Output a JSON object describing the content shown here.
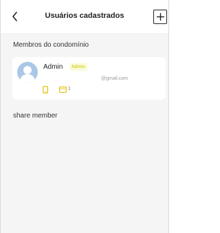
{
  "header": {
    "title": "Usuários cadastrados",
    "back_icon": "chevron-left-icon",
    "add_icon": "plus-icon"
  },
  "members_section": {
    "title": "Membros do condomínio"
  },
  "member": {
    "name": "Admin",
    "badge": "Admin",
    "email": "@gmail.com",
    "card_count": "1",
    "avatar_icon": "user-avatar-icon",
    "phone_icon": "phone-icon",
    "card_icon": "card-icon"
  },
  "share_section": {
    "title": "share member"
  },
  "colors": {
    "background": "#f5f5f5",
    "accent": "#e0c200",
    "badge_text": "#c9c900",
    "badge_bg": "#fbfbdc",
    "avatar": "#a9c7e6"
  }
}
